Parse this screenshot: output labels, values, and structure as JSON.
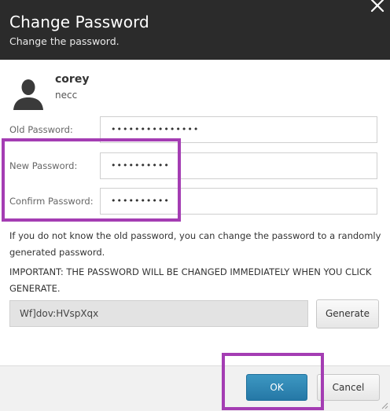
{
  "dialog": {
    "title": "Change Password",
    "subtitle": "Change the password.",
    "close_icon": "close-icon"
  },
  "user": {
    "avatar_icon": "user-avatar-icon",
    "name": "corey",
    "domain": "necc"
  },
  "form": {
    "old_password": {
      "label": "Old Password:",
      "value": "•••••••••••••••"
    },
    "new_password": {
      "label": "New Password:",
      "value": "••••••••••"
    },
    "confirm_password": {
      "label": "Confirm Password:",
      "value": "••••••••••"
    }
  },
  "info": {
    "line1": "If you do not know the old password, you can change the password to a randomly",
    "line2": "generated password.",
    "important1": "IMPORTANT: THE PASSWORD WILL BE CHANGED IMMEDIATELY WHEN YOU CLICK",
    "important2": "GENERATE."
  },
  "generate": {
    "generated_value": "Wf]dov:HVspXqx",
    "button_label": "Generate"
  },
  "footer": {
    "ok_label": "OK",
    "cancel_label": "Cancel"
  },
  "colors": {
    "header_bg": "#2b2b2b",
    "highlight": "#a43db3",
    "ok_button": "#2e86b5"
  }
}
